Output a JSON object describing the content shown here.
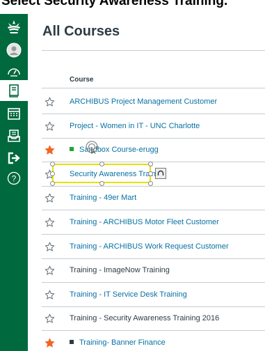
{
  "caption": "Select Security Awareness Training.",
  "page": {
    "title": "All Courses",
    "column_header": "Course"
  },
  "colors": {
    "sidebar": "#00693e",
    "link": "#0770a3",
    "text": "#2d3b45",
    "favorite_star": "#f26522",
    "selection": "#e8e000"
  },
  "nav": [
    {
      "name": "logo-icon",
      "icon": "unc-charlotte-crown"
    },
    {
      "name": "account-icon",
      "icon": "user-avatar"
    },
    {
      "name": "dashboard-icon",
      "icon": "speedometer"
    },
    {
      "name": "courses-icon",
      "icon": "book",
      "active": true
    },
    {
      "name": "calendar-icon",
      "icon": "calendar"
    },
    {
      "name": "inbox-icon",
      "icon": "inbox-tray"
    },
    {
      "name": "commons-icon",
      "icon": "arrow-into-box"
    },
    {
      "name": "help-icon",
      "icon": "question-circle"
    }
  ],
  "courses": [
    {
      "name": "ARCHIBUS Project Management Customer",
      "link": true,
      "favorite": false
    },
    {
      "name": "Project - Women in IT - UNC Charlotte",
      "link": true,
      "favorite": false
    },
    {
      "name": "Sandbox Course-erugg",
      "link": true,
      "favorite": true,
      "swatch": "#1aa737"
    },
    {
      "name": "Security Awareness Training",
      "link": true,
      "favorite": false,
      "selected": true
    },
    {
      "name": "Training - 49er Mart",
      "link": true,
      "favorite": false
    },
    {
      "name": "Training - ARCHIBUS Motor Fleet Customer",
      "link": true,
      "favorite": false
    },
    {
      "name": "Training - ARCHIBUS Work Request Customer",
      "link": true,
      "favorite": false
    },
    {
      "name": "Training - ImageNow Training",
      "link": false,
      "favorite": false
    },
    {
      "name": "Training - IT Service Desk Training",
      "link": true,
      "favorite": false
    },
    {
      "name": "Training - Security Awareness Training 2016",
      "link": false,
      "favorite": false
    },
    {
      "name": "Training- Banner Finance",
      "link": true,
      "favorite": true,
      "swatch": "#2d3b45"
    }
  ]
}
